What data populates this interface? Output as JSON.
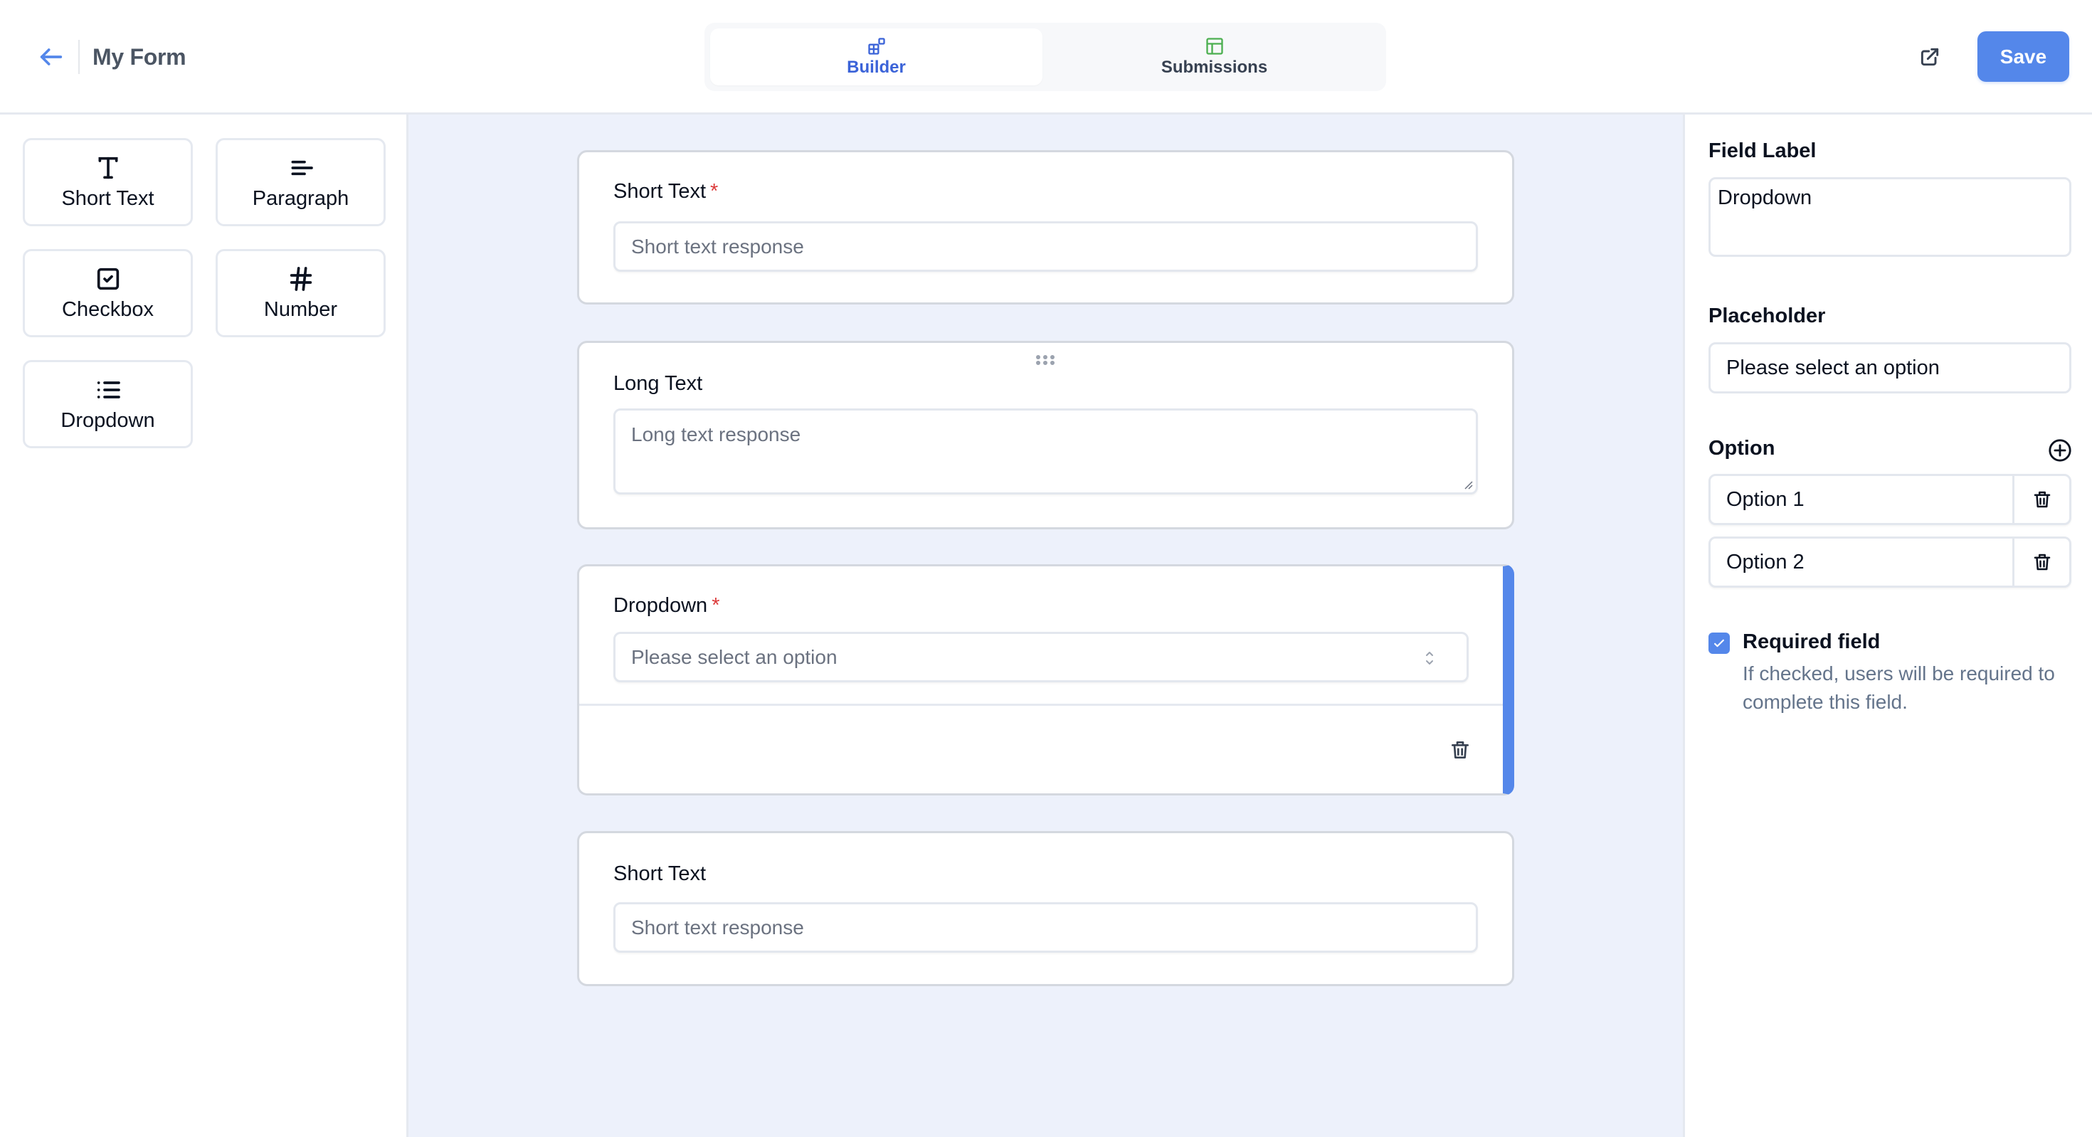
{
  "header": {
    "back_label": "Back",
    "title": "My Form",
    "tabs": [
      {
        "label": "Builder",
        "icon": "layout-grid-icon",
        "active": true,
        "color": "#3b63d8"
      },
      {
        "label": "Submissions",
        "icon": "table-icon",
        "active": false,
        "color": "#4caf50"
      }
    ],
    "open_external_icon": "external-link-icon",
    "save_label": "Save",
    "accent_color": "#5487ea"
  },
  "sidebar": {
    "items": [
      {
        "label": "Short Text",
        "icon": "text-t-icon"
      },
      {
        "label": "Paragraph",
        "icon": "align-left-icon"
      },
      {
        "label": "Checkbox",
        "icon": "checkbox-icon"
      },
      {
        "label": "Number",
        "icon": "hash-icon"
      },
      {
        "label": "Dropdown",
        "icon": "list-icon"
      }
    ]
  },
  "canvas": {
    "fields": [
      {
        "label": "Short Text",
        "required": true,
        "required_mark": "*",
        "type": "short_text",
        "placeholder": "Short text response"
      },
      {
        "label": "Long Text",
        "required": false,
        "type": "long_text",
        "placeholder": "Long text response"
      },
      {
        "label": "Dropdown",
        "required": true,
        "required_mark": "*",
        "type": "dropdown",
        "placeholder": "Please select an option",
        "selected": true
      },
      {
        "label": "Short Text",
        "required": false,
        "type": "short_text",
        "placeholder": "Short text response"
      }
    ]
  },
  "properties": {
    "field_label_title": "Field Label",
    "field_label_value": "Dropdown",
    "placeholder_title": "Placeholder",
    "placeholder_value": "Please select an option",
    "option_title": "Option",
    "options": [
      "Option 1",
      "Option 2"
    ],
    "required_checked": true,
    "required_title": "Required field",
    "required_help": "If checked, users will be required to complete this field."
  }
}
